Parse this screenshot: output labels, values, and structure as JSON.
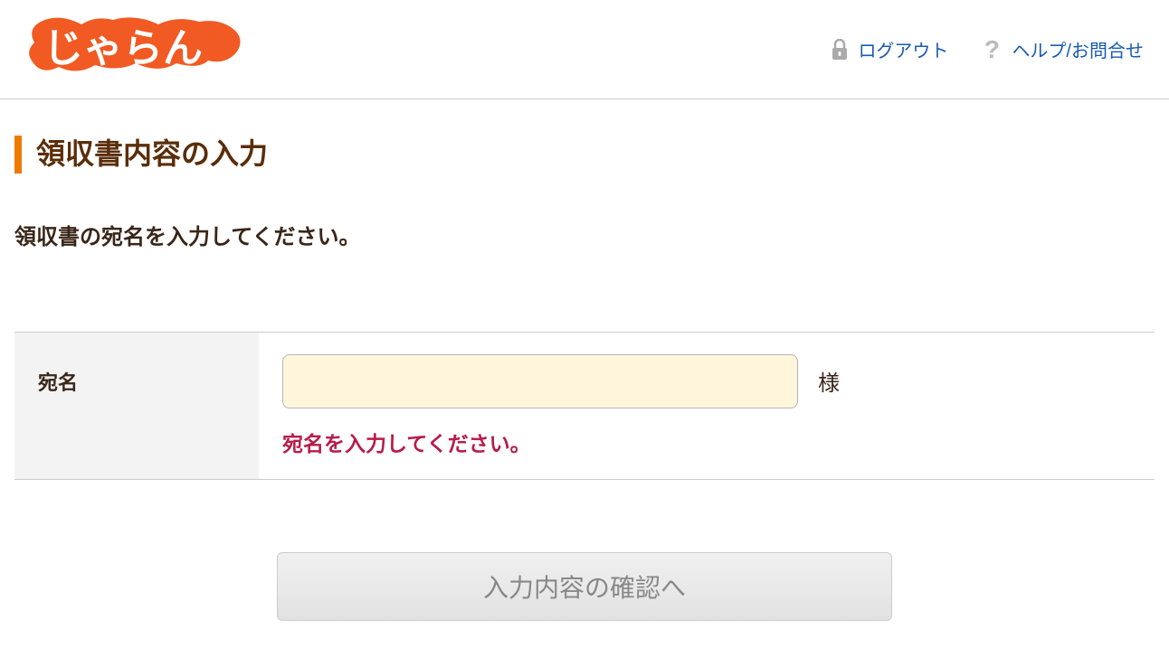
{
  "header": {
    "logout_label": "ログアウト",
    "help_label": "ヘルプ/お問合せ"
  },
  "page": {
    "title": "領収書内容の入力",
    "instruction": "領収書の宛名を入力してください。"
  },
  "form": {
    "recipient_label": "宛名",
    "recipient_value": "",
    "recipient_suffix": "様",
    "error_message": "宛名を入力してください。"
  },
  "button": {
    "submit_label": "入力内容の確認へ"
  }
}
